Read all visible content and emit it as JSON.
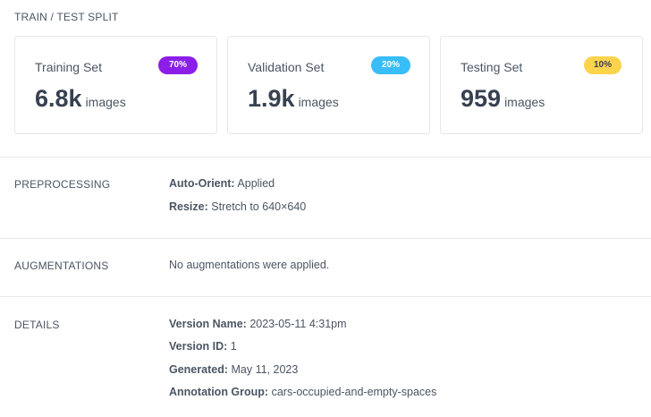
{
  "split": {
    "title": "TRAIN / TEST SPLIT",
    "cards": [
      {
        "label": "Training Set",
        "badge": "70%",
        "count": "6.8k",
        "unit": "images",
        "badge_color": "#8b1ee8"
      },
      {
        "label": "Validation Set",
        "badge": "20%",
        "count": "1.9k",
        "unit": "images",
        "badge_color": "#38bdf8"
      },
      {
        "label": "Testing Set",
        "badge": "10%",
        "count": "959",
        "unit": "images",
        "badge_color": "#fcd34d"
      }
    ]
  },
  "preprocessing": {
    "label": "PREPROCESSING",
    "items": [
      {
        "key": "Auto-Orient:",
        "value": "Applied"
      },
      {
        "key": "Resize:",
        "value": "Stretch to 640×640"
      }
    ]
  },
  "augmentations": {
    "label": "AUGMENTATIONS",
    "text": "No augmentations were applied."
  },
  "details": {
    "label": "DETAILS",
    "items": [
      {
        "key": "Version Name:",
        "value": "2023-05-11 4:31pm"
      },
      {
        "key": "Version ID:",
        "value": "1"
      },
      {
        "key": "Generated:",
        "value": "May 11, 2023"
      },
      {
        "key": "Annotation Group:",
        "value": "cars-occupied-and-empty-spaces"
      }
    ]
  }
}
